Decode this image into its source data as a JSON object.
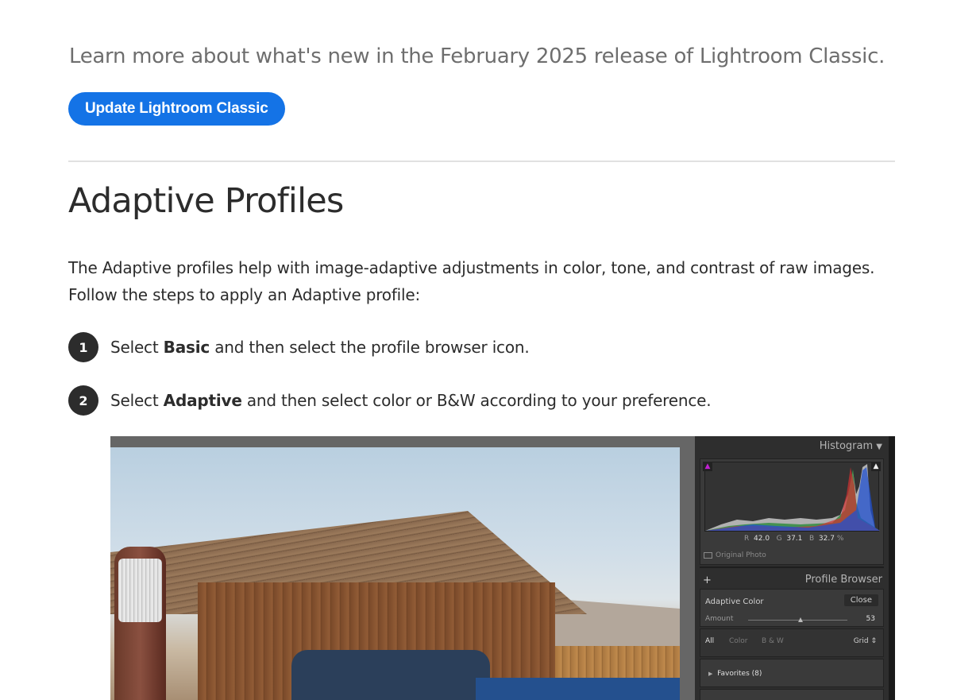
{
  "intro_text": "Learn more about what's new in the February 2025 release of Lightroom Classic.",
  "cta_label": "Update Lightroom Classic",
  "section_title": "Adaptive Profiles",
  "section_body": "The Adaptive profiles help with image-adaptive adjustments in color, tone, and contrast of raw images. Follow the steps to apply an Adaptive profile:",
  "steps": [
    {
      "number": "1",
      "prefix": "Select ",
      "bold": "Basic",
      "suffix": " and then select the profile browser icon."
    },
    {
      "number": "2",
      "prefix": "Select ",
      "bold": "Adaptive",
      "suffix": " and then select color or B&W according to your preference."
    }
  ],
  "panel": {
    "histogram_title": "Histogram",
    "histogram_collapse_icon": "triangle-down-icon",
    "clip_shadow_icon": "triangle-up-icon",
    "clip_highlight_icon": "triangle-up-icon",
    "readout": {
      "r_label": "R",
      "r_value": "42.0",
      "g_label": "G",
      "g_value": "37.1",
      "b_label": "B",
      "b_value": "32.7",
      "unit": "%"
    },
    "original_photo_label": "Original Photo",
    "add_icon": "plus-icon",
    "profile_browser_title": "Profile Browser",
    "profile_name": "Adaptive Color",
    "close_label": "Close",
    "amount_label": "Amount",
    "amount_value": "53",
    "amount_fraction": 0.53,
    "filters": [
      "All",
      "Color",
      "B & W"
    ],
    "active_filter": "All",
    "view_label": "Grid",
    "favorites_label": "Favorites (8)"
  },
  "colors": {
    "cta_bg": "#1473e6",
    "heading": "#2c2c2c",
    "intro": "#6e6e6e",
    "panel_bg": "#2e2e2e"
  }
}
